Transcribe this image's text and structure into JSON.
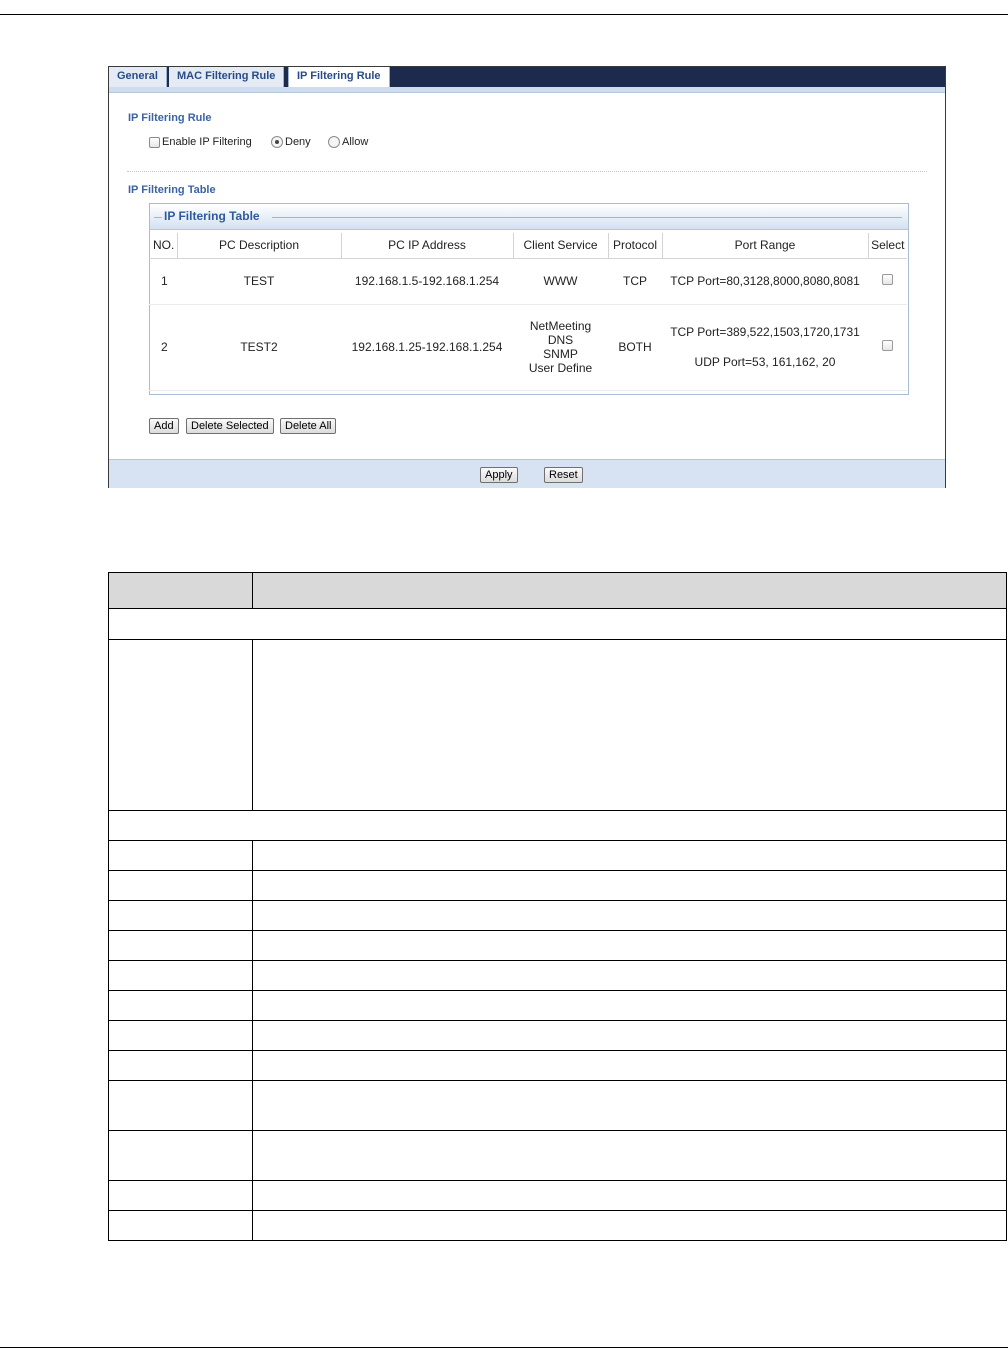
{
  "tabs": [
    {
      "label": "General"
    },
    {
      "label": "MAC Filtering Rule"
    },
    {
      "label": "IP Filtering Rule"
    }
  ],
  "rule_section": {
    "title": "IP Filtering Rule",
    "enable_label": "Enable IP Filtering",
    "deny_label": "Deny",
    "allow_label": "Allow",
    "enabled": false,
    "selected_action": "Deny"
  },
  "table_section": {
    "title": "IP Filtering Table",
    "fieldset_title": "IP Filtering Table",
    "columns": [
      "NO.",
      "PC Description",
      "PC IP Address",
      "Client Service",
      "Protocol",
      "Port Range",
      "Select"
    ],
    "rows": [
      {
        "no": "1",
        "description": "TEST",
        "ip": "192.168.1.5-192.168.1.254",
        "services": [
          "WWW"
        ],
        "protocol": "TCP",
        "ports": [
          "TCP Port=80,3128,8000,8080,8081"
        ]
      },
      {
        "no": "2",
        "description": "TEST2",
        "ip": "192.168.1.25-192.168.1.254",
        "services": [
          "NetMeeting",
          "DNS",
          "SNMP",
          "User Define"
        ],
        "protocol": "BOTH",
        "ports": [
          "TCP Port=389,522,1503,1720,1731",
          "UDP Port=53, 161,162, 20"
        ]
      }
    ]
  },
  "buttons": {
    "add": "Add",
    "delete_selected": "Delete Selected",
    "delete_all": "Delete All",
    "apply": "Apply",
    "reset": "Reset"
  }
}
